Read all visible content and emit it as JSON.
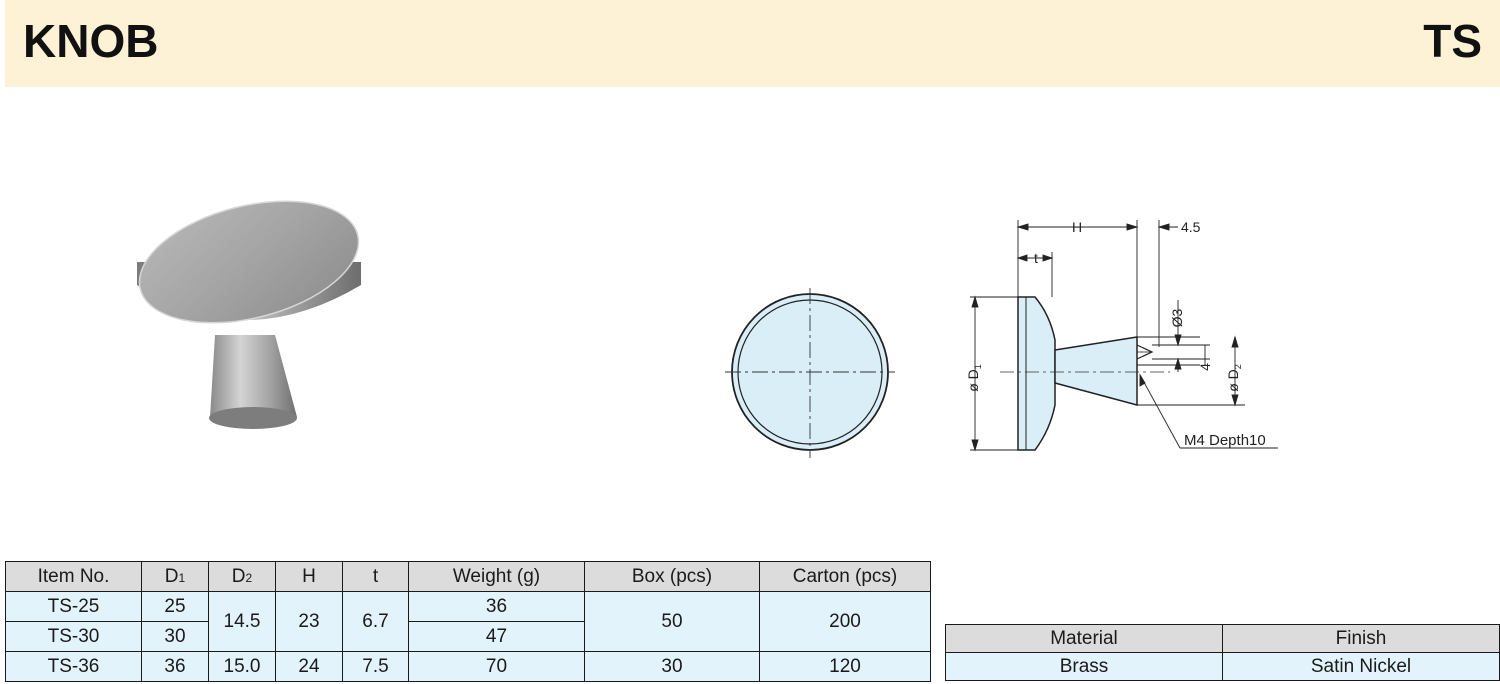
{
  "header": {
    "title": "KNOB",
    "code": "TS"
  },
  "drawing": {
    "dim_H": "H",
    "dim_45": "4.5",
    "dim_t": "t",
    "dim_D1": "ø D",
    "dim_D1_sub": "1",
    "dim_D2": "ø D",
    "dim_D2_sub": "2",
    "dim_phi3": "Ø3",
    "dim_4": "4",
    "callout": "M4 Depth10"
  },
  "spec_table": {
    "headers": {
      "item": "Item No.",
      "d1": "D",
      "d1_sub": "1",
      "d2": "D",
      "d2_sub": "2",
      "h": "H",
      "t": "t",
      "weight": "Weight (g)",
      "box": "Box (pcs)",
      "carton": "Carton (pcs)"
    },
    "rows": [
      {
        "item": "TS-25",
        "d1": "25",
        "d2": "14.5",
        "h": "23",
        "t": "6.7",
        "weight": "36",
        "box": "50",
        "carton": "200"
      },
      {
        "item": "TS-30",
        "d1": "30",
        "weight": "47"
      },
      {
        "item": "TS-36",
        "d1": "36",
        "d2": "15.0",
        "h": "24",
        "t": "7.5",
        "weight": "70",
        "box": "30",
        "carton": "120"
      }
    ]
  },
  "material_table": {
    "headers": {
      "material": "Material",
      "finish": "Finish"
    },
    "row": {
      "material": "Brass",
      "finish": "Satin Nickel"
    }
  },
  "colors": {
    "header_bg": "#fdf2d6",
    "cell_bg": "#e3f3fc",
    "header_cell_bg": "#dcdcdc",
    "drawing_fill": "#daeef8"
  }
}
